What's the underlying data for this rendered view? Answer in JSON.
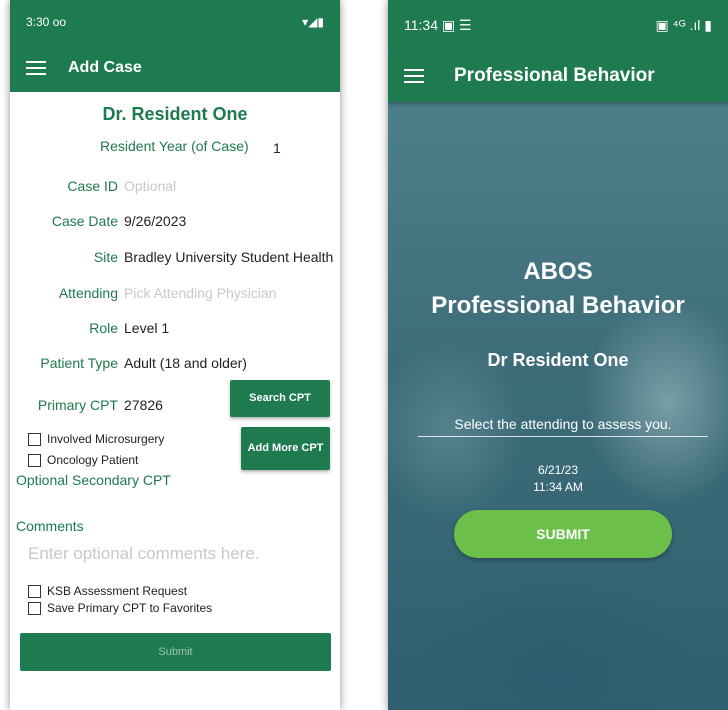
{
  "left": {
    "status": {
      "time": "3:30",
      "indicator": "oo",
      "icons": "▾◢▮"
    },
    "appbar": {
      "title": "Add Case"
    },
    "doctor_name": "Dr. Resident One",
    "resident_year": {
      "label": "Resident Year (of Case)",
      "value": "1"
    },
    "fields": {
      "case_id": {
        "label": "Case ID",
        "placeholder": "Optional"
      },
      "case_date": {
        "label": "Case Date",
        "value": "9/26/2023"
      },
      "site": {
        "label": "Site",
        "value": "Bradley University Student Health"
      },
      "attending": {
        "label": "Attending",
        "placeholder": "Pick Attending Physician"
      },
      "role": {
        "label": "Role",
        "value": "Level 1"
      },
      "patient_type": {
        "label": "Patient Type",
        "value": "Adult (18 and older)"
      },
      "primary_cpt": {
        "label": "Primary CPT",
        "value": "27826"
      }
    },
    "search_cpt_label": "Search CPT",
    "add_more_cpt_label": "Add More CPT",
    "checkboxes": {
      "involved_microsurgery": "Involved Microsurgery",
      "oncology_patient": "Oncology Patient",
      "ksb_request": "KSB Assessment Request",
      "save_primary": "Save Primary CPT to Favorites"
    },
    "optional_secondary_cpt": "Optional Secondary CPT",
    "comments_label": "Comments",
    "comments_placeholder": "Enter optional comments here.",
    "submit_label": "Submit"
  },
  "right": {
    "status": {
      "time": "11:34",
      "icons": "▣ ⁴ᴳ .ıl ▮"
    },
    "appbar": {
      "title": "Professional Behavior"
    },
    "heading_line1": "ABOS",
    "heading_line2": "Professional Behavior",
    "resident_name": "Dr Resident One",
    "select_attending": "Select the attending to assess you.",
    "date": "6/21/23",
    "time": "11:34 AM",
    "submit_label": "SUBMIT"
  },
  "colors": {
    "brand_green": "#1e7a4f",
    "submit_green": "#6cc04a"
  }
}
